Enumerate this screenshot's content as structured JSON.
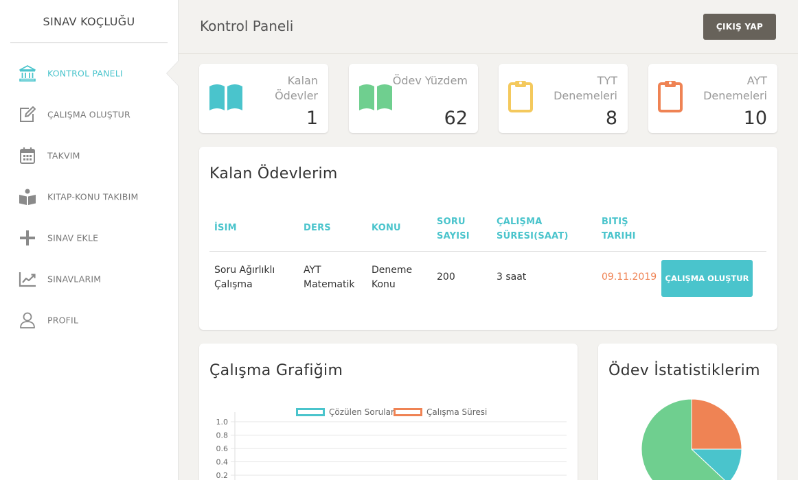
{
  "sidebar": {
    "brand": "SINAV KOÇLUĞU",
    "items": [
      {
        "label": "KONTROL PANELI",
        "icon": "bank-icon",
        "active": true
      },
      {
        "label": "ÇALIŞMA OLUŞTUR",
        "icon": "edit-icon"
      },
      {
        "label": "TAKVIM",
        "icon": "calendar-icon"
      },
      {
        "label": "KITAP-KONU TAKIBIM",
        "icon": "book-reader-icon"
      },
      {
        "label": "SINAV EKLE",
        "icon": "plus-icon"
      },
      {
        "label": "SINAVLARIM",
        "icon": "chart-line-icon"
      },
      {
        "label": "PROFIL",
        "icon": "user-icon"
      }
    ]
  },
  "header": {
    "title": "Kontrol Paneli",
    "logout_label": "ÇIKIŞ YAP"
  },
  "stats": [
    {
      "label": "Kalan Ödevler",
      "value": "1",
      "icon": "open-book-icon",
      "color": "#4ac4cc"
    },
    {
      "label": "Ödev Yüzdem",
      "value": "62",
      "icon": "open-book-icon",
      "color": "#6fcf8f"
    },
    {
      "label": "TYT Denemeleri",
      "value": "8",
      "icon": "clipboard-icon",
      "color": "#f4c95d"
    },
    {
      "label": "AYT Denemeleri",
      "value": "10",
      "icon": "clipboard-icon",
      "color": "#ef8354"
    }
  ],
  "assignments": {
    "title": "Kalan Ödevlerim",
    "columns": [
      "İSIM",
      "DERS",
      "KONU",
      "SORU SAYISI",
      "ÇALIŞMA SÜRESI(SAAT)",
      "BITIŞ TARIHI"
    ],
    "rows": [
      {
        "name": "Soru Ağırlıklı Çalışma",
        "course": "AYT Matematik",
        "topic": "Deneme Konu",
        "questions": "200",
        "duration": "3 saat",
        "due": "09.11.2019",
        "action": "ÇALIŞMA OLUŞTUR"
      }
    ]
  },
  "study_chart": {
    "title": "Çalışma Grafiğim"
  },
  "homework_stats": {
    "title": "Ödev İstatistiklerim"
  },
  "chart_data": [
    {
      "type": "line",
      "title": "",
      "series": [
        {
          "name": "Çözülen Sorular",
          "values": [],
          "color": "#4ac4cc"
        },
        {
          "name": "Çalışma Süresi",
          "values": [],
          "color": "#ef8354"
        }
      ],
      "yticks": [
        "1.0",
        "0.8",
        "0.6",
        "0.4",
        "0.2"
      ],
      "ylim": [
        0,
        1
      ],
      "grid": true,
      "legend": "top"
    },
    {
      "type": "pie",
      "title": "",
      "values": [
        0.25,
        0.12,
        0.63
      ],
      "colors": [
        "#ef8354",
        "#4ac4cc",
        "#6fcf8f"
      ]
    }
  ],
  "colors": {
    "accent": "#4ac4cc",
    "due_date": "#ef8354",
    "button_dark": "#67625a"
  }
}
